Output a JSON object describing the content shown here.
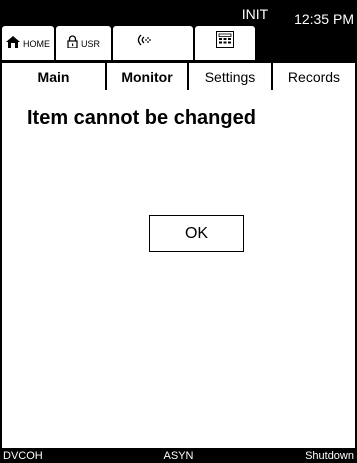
{
  "topbar": {
    "home_label": "HOME",
    "usr_label": "USR",
    "status_mode": "INIT",
    "time": "12:35 PM"
  },
  "tabs": [
    {
      "label": "Main",
      "active": true
    },
    {
      "label": "Monitor",
      "active": true
    },
    {
      "label": "Settings",
      "active": false
    },
    {
      "label": "Records",
      "active": false
    }
  ],
  "dialog": {
    "message": "Item cannot be changed",
    "ok_label": "OK"
  },
  "bottombar": {
    "left": "DVCOH",
    "center": "ASYN",
    "right": "Shutdown"
  }
}
